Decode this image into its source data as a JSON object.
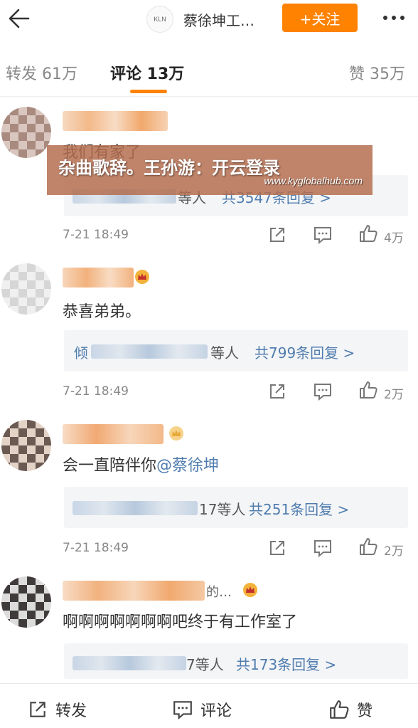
{
  "header": {
    "logo_text": "KLN",
    "title": "蔡徐坤工…",
    "follow_label": "+关注"
  },
  "tabs": {
    "repost": "转发 61万",
    "comment": "评论 13万",
    "like": "赞 35万"
  },
  "banner": {
    "title": "杂曲歌辞。王孙游：开云登录",
    "url": "www.kyglobalhub.com"
  },
  "comments": [
    {
      "text": "我们有家了",
      "replies_suffix": "等人",
      "replies_link": "共3547条回复 >",
      "time": "7-21 18:49",
      "likes": "4万"
    },
    {
      "text": "恭喜弟弟。",
      "replies_prefix": "倾",
      "replies_suffix": "等人",
      "replies_link": "共799条回复 >",
      "time": "7-21 18:49",
      "likes": "2万"
    },
    {
      "text_prefix": "会一直陪伴你",
      "mention": "@蔡徐坤",
      "replies_suffix": "17等人",
      "replies_link": "共251条回复 >",
      "time": "7-21 18:49",
      "likes": "2万"
    },
    {
      "name_suffix": "的…",
      "text": "啊啊啊啊啊啊啊吧终于有工作室了",
      "replies_suffix": "7等人",
      "replies_link": "共173条回复 >"
    }
  ],
  "bottom": {
    "repost": "转发",
    "comment": "评论",
    "like": "赞"
  },
  "colors": {
    "accent": "#ff8200",
    "link": "#507daf"
  }
}
